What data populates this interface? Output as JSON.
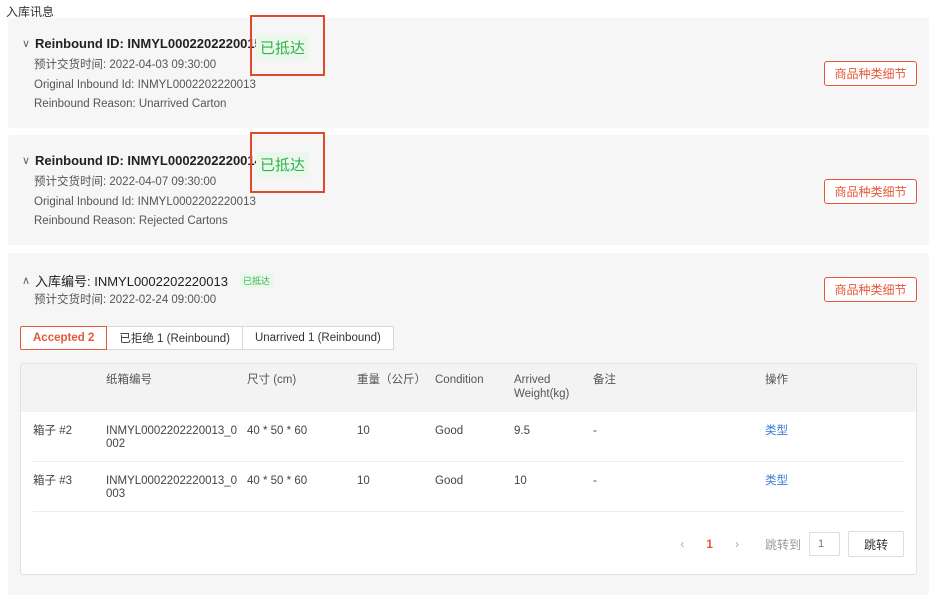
{
  "section_title": "入库讯息",
  "detail_button_label": "商品种类细节",
  "status_label": "已抵达",
  "cards": [
    {
      "id_label": "Reinbound ID: INMYL0002202220015",
      "expected_time": "预计交货时间: 2022-04-03 09:30:00",
      "original_inbound": "Original Inbound Id: INMYL0002202220013",
      "reason": "Reinbound Reason: Unarrived Carton",
      "chevron": "chevron-down-icon"
    },
    {
      "id_label": "Reinbound ID: INMYL0002202220014",
      "expected_time": "预计交货时间: 2022-04-07 09:30:00",
      "original_inbound": "Original Inbound Id: INMYL0002202220013",
      "reason": "Reinbound Reason: Rejected Cartons",
      "chevron": "chevron-down-icon"
    },
    {
      "id_label": "入库编号: INMYL0002202220013",
      "expected_time": "预计交货时间: 2022-02-24 09:00:00",
      "chevron": "chevron-up-icon"
    }
  ],
  "tabs": [
    {
      "label": "Accepted 2",
      "active": true
    },
    {
      "label": "已拒绝 1 (Reinbound)",
      "active": false
    },
    {
      "label": "Unarrived 1 (Reinbound)",
      "active": false
    }
  ],
  "table": {
    "headers": {
      "carton_no": "纸箱编号",
      "size": "尺寸 (cm)",
      "weight": "重量（公斤）",
      "condition": "Condition",
      "arrived_weight_1": "Arrived",
      "arrived_weight_2": "Weight(kg)",
      "remark": "备注",
      "action": "操作"
    },
    "rows": [
      {
        "box": "箱子 #2",
        "carton_1": "INMYL0002202220013_0",
        "carton_2": "002",
        "size": "40 * 50 * 60",
        "weight": "10",
        "condition": "Good",
        "arrived_weight": "9.5",
        "remark": "-",
        "action": "类型"
      },
      {
        "box": "箱子 #3",
        "carton_1": "INMYL0002202220013_0",
        "carton_2": "003",
        "size": "40 * 50 * 60",
        "weight": "10",
        "condition": "Good",
        "arrived_weight": "10",
        "remark": "-",
        "action": "类型"
      }
    ]
  },
  "pagination": {
    "prev": "‹",
    "current_page": "1",
    "next": "›",
    "jump_label": "跳转到",
    "jump_placeholder": "1",
    "jump_button": "跳转"
  },
  "colors": {
    "accent": "#e4593a",
    "status_green": "#2fb24c",
    "link_blue": "#3a7bd5",
    "highlight_box": "#e04a2c"
  }
}
